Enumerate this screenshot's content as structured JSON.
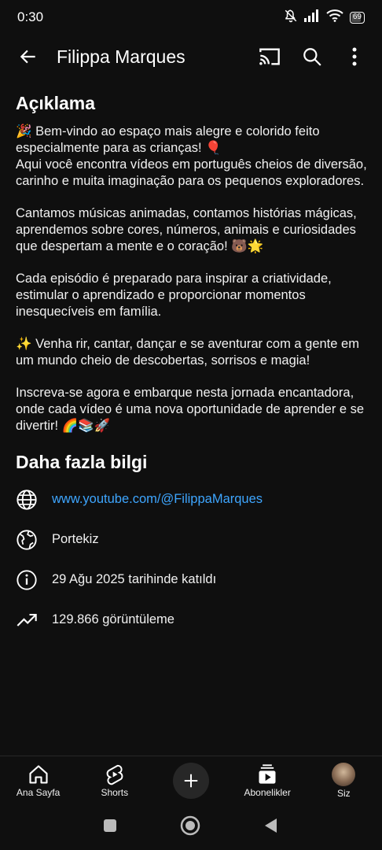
{
  "status": {
    "time": "0:30",
    "battery": "69"
  },
  "appbar": {
    "title": "Filippa Marques"
  },
  "description": {
    "heading": "Açıklama",
    "paragraphs": [
      "🎉 Bem-vindo ao espaço mais alegre e colorido feito especialmente para as crianças! 🎈\nAqui você encontra vídeos em português cheios de diversão, carinho e muita imaginação para os pequenos exploradores.",
      "Cantamos músicas animadas, contamos histórias mágicas, aprendemos sobre cores, números, animais e curiosidades que despertam a mente e o coração! 🐻🌟",
      "Cada episódio é preparado para inspirar a criatividade, estimular o aprendizado e proporcionar momentos inesquecíveis em família.",
      "✨ Venha rir, cantar, dançar e se aventurar com a gente em um mundo cheio de descobertas, sorrisos e magia!",
      "Inscreva-se agora e embarque nesta jornada encantadora, onde cada vídeo é uma nova oportunidade de aprender e se divertir! 🌈📚🚀"
    ]
  },
  "more_info": {
    "heading": "Daha fazla bilgi",
    "link": "www.youtube.com/@FilippaMarques",
    "country": "Portekiz",
    "joined": "29 Ağu 2025 tarihinde katıldı",
    "views": "129.866 görüntüleme"
  },
  "bottom_nav": {
    "home": "Ana Sayfa",
    "shorts": "Shorts",
    "subscriptions": "Abonelikler",
    "you": "Siz"
  },
  "colors": {
    "background": "#0f0f0f",
    "link": "#3ea6ff",
    "text": "#f1f1f1"
  }
}
